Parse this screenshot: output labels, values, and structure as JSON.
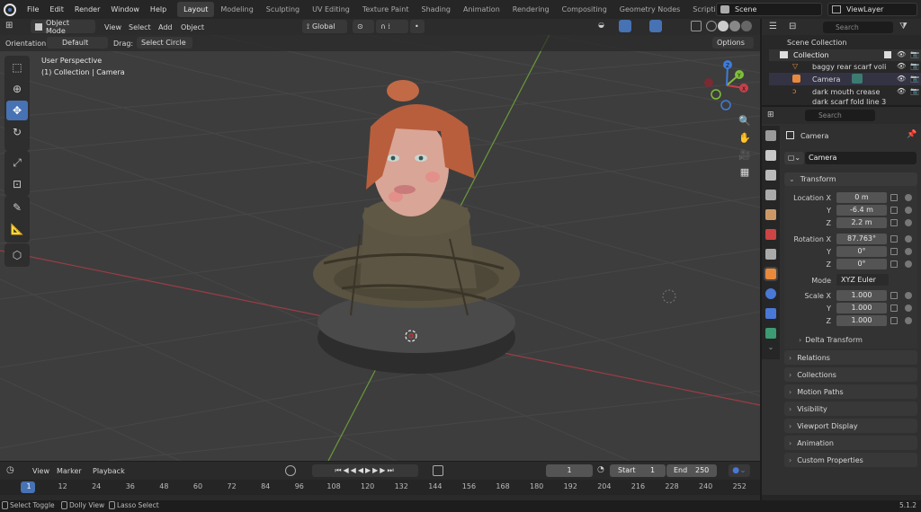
{
  "menubar": {
    "items": [
      "File",
      "Edit",
      "Render",
      "Window",
      "Help"
    ],
    "workspaces": [
      "Layout",
      "Modeling",
      "Sculpting",
      "UV Editing",
      "Texture Paint",
      "Shading",
      "Animation",
      "Rendering",
      "Compositing",
      "Geometry Nodes",
      "Scripting"
    ],
    "active_workspace": "Layout",
    "add_tab": "+",
    "scene": "Scene",
    "view_layer": "ViewLayer"
  },
  "viewport_header": {
    "mode": "Object Mode",
    "menus": [
      "View",
      "Select",
      "Add",
      "Object"
    ],
    "transform_orientation": "Global"
  },
  "tool_settings": {
    "orientation_label": "Orientation:",
    "orientation_value": "Default",
    "drag_label": "Drag:",
    "drag_value": "Select Circle",
    "options": "Options"
  },
  "viewport": {
    "perspective": "User Perspective",
    "collection_info": "(1) Collection | Camera"
  },
  "gizmo": {
    "x": "X",
    "y": "Y",
    "z": "Z"
  },
  "outliner": {
    "search_placeholder": "Search",
    "root": "Scene Collection",
    "collection": "Collection",
    "items": [
      "baggy rear scarf voli",
      "Camera",
      "dark mouth crease",
      "dark scarf fold line 3"
    ]
  },
  "properties": {
    "search_placeholder": "Search",
    "object_name": "Camera",
    "object_field": "Camera",
    "transform": {
      "title": "Transform",
      "location_label": "Location X",
      "loc_x": "0 m",
      "loc_y": "-6.4 m",
      "loc_z": "2.2 m",
      "rotation_label": "Rotation X",
      "rot_x": "87.763°",
      "rot_y": "0°",
      "rot_z": "0°",
      "mode_label": "Mode",
      "mode_value": "XYZ Euler",
      "scale_label": "Scale X",
      "sc_x": "1.000",
      "sc_y": "1.000",
      "sc_z": "1.000",
      "y_label": "Y",
      "z_label": "Z",
      "delta": "Delta Transform"
    },
    "sections": [
      "Relations",
      "Collections",
      "Motion Paths",
      "Visibility",
      "Viewport Display",
      "Animation",
      "Custom Properties"
    ]
  },
  "timeline": {
    "menus": [
      "View",
      "Marker",
      "Playback"
    ],
    "current_frame": "1",
    "start_label": "Start",
    "start": "1",
    "end_label": "End",
    "end": "250",
    "frames": [
      "1",
      "12",
      "24",
      "36",
      "48",
      "60",
      "72",
      "84",
      "96",
      "108",
      "120",
      "132",
      "144",
      "156",
      "168",
      "180",
      "192",
      "204",
      "216",
      "228",
      "240",
      "252"
    ]
  },
  "statusbar": {
    "select": "Select Toggle",
    "dolly": "Dolly View",
    "lasso": "Lasso Select",
    "version": "5.1.2"
  }
}
